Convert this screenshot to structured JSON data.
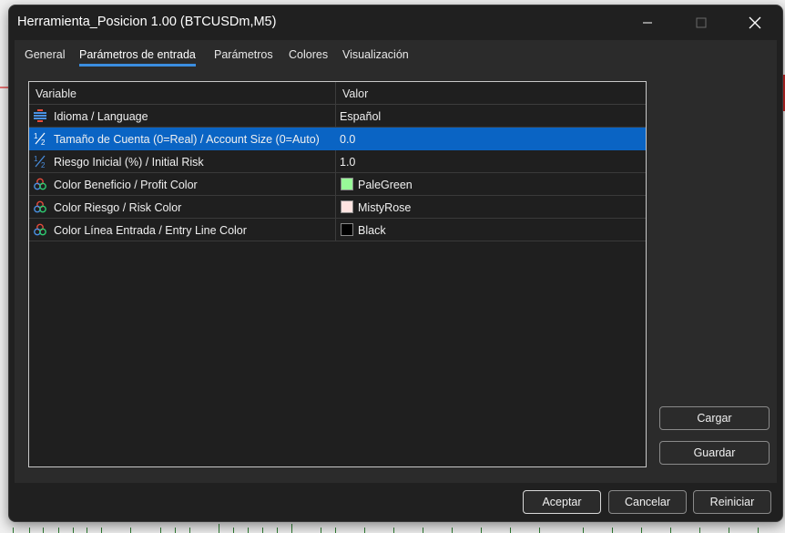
{
  "window": {
    "title": "Herramienta_Posicion 1.00 (BTCUSDm,M5)",
    "controls": {
      "minimize": "minimize-icon",
      "maximize": "maximize-icon",
      "close": "close-icon"
    }
  },
  "tabs": [
    {
      "label": "General",
      "active": false
    },
    {
      "label": "Parámetros de entrada",
      "active": true
    },
    {
      "label": "Parámetros",
      "active": false
    },
    {
      "label": "Colores",
      "active": false
    },
    {
      "label": "Visualización",
      "active": false
    }
  ],
  "grid": {
    "headers": {
      "variable": "Variable",
      "value": "Valor"
    },
    "rows": [
      {
        "icon": "enum-icon",
        "name": "Idioma / Language",
        "value": "Español",
        "selected": false
      },
      {
        "icon": "fraction-icon",
        "name": "Tamaño de Cuenta (0=Real) / Account Size (0=Auto)",
        "value": "0.0",
        "selected": true
      },
      {
        "icon": "fraction-icon",
        "name": "Riesgo Inicial (%) / Initial Risk",
        "value": "1.0",
        "selected": false
      },
      {
        "icon": "color-icon",
        "name": "Color Beneficio / Profit Color",
        "value": "PaleGreen",
        "swatch": "#98fb98",
        "selected": false
      },
      {
        "icon": "color-icon",
        "name": "Color Riesgo / Risk Color",
        "value": "MistyRose",
        "swatch": "#ffe4e1",
        "selected": false
      },
      {
        "icon": "color-icon",
        "name": "Color Línea Entrada / Entry Line Color",
        "value": "Black",
        "swatch": "#000000",
        "selected": false
      }
    ]
  },
  "side_buttons": {
    "load": "Cargar",
    "save": "Guardar"
  },
  "footer_buttons": {
    "ok": "Aceptar",
    "cancel": "Cancelar",
    "reset": "Reiniciar"
  },
  "colors": {
    "selection": "#0a64c4",
    "accent": "#3b8ee0",
    "window_bg": "#202020",
    "panel_bg": "#2b2b2b"
  }
}
